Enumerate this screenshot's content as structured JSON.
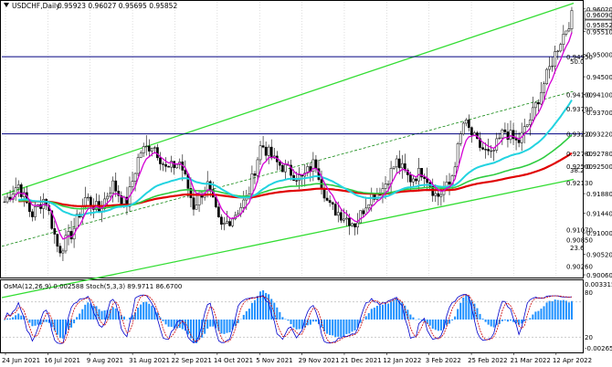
{
  "header": {
    "symbol": "USDCHF,Daily",
    "ohlc": "0.95923 0.96027 0.95695 0.95852"
  },
  "price_axis": {
    "ticks": [
      "0.96020",
      "0.95510",
      "0.95000",
      "0.94500",
      "0.94100",
      "0.93700",
      "0.93220",
      "0.92780",
      "0.92500",
      "0.91880",
      "0.91440",
      "0.91000",
      "0.90520",
      "0.90060"
    ],
    "ylim": [
      0.9002,
      0.9618
    ],
    "current_price": "0.95852",
    "tag_ask": "0.96090",
    "level_labels": [
      "0.94950",
      "0.94100",
      "0.93790",
      "0.93220",
      "0.92780",
      "0.92500",
      "0.92130",
      "0.91070",
      "0.90850",
      "0.90260"
    ]
  },
  "fib_labels": [
    "50.0",
    "38.2",
    "23.6"
  ],
  "time_axis": {
    "labels": [
      "24 Jun 2021",
      "16 Jul 2021",
      "9 Aug 2021",
      "31 Aug 2021",
      "22 Sep 2021",
      "14 Oct 2021",
      "5 Nov 2021",
      "29 Nov 2021",
      "21 Dec 2021",
      "12 Jan 2022",
      "3 Feb 2022",
      "25 Feb 2022",
      "21 Mar 2022",
      "12 Apr 2022"
    ]
  },
  "indicator": {
    "label": "OsMA(12,26,9) 0.002588  Stoch(5,3,3) 89.9711 86.6700",
    "axis_ticks": [
      "0.00331585",
      "80",
      "20",
      "-0.00265849"
    ]
  },
  "colors": {
    "bull_candle": "#000000",
    "bear_candle": "#000000",
    "ema_fast": "#d400d4",
    "ema_mid": "#22d3e0",
    "ema_slow_green": "#2ecc40",
    "ema_red": "#e00000",
    "channel": "#33dd33",
    "hline": "#000080",
    "osma": "#1e90ff",
    "stoch": "#0000cc"
  },
  "chart_data": {
    "type": "candlestick",
    "x": [
      "24 Jun 2021",
      "16 Jul 2021",
      "9 Aug 2021",
      "31 Aug 2021",
      "22 Sep 2021",
      "14 Oct 2021",
      "5 Nov 2021",
      "29 Nov 2021",
      "21 Dec 2021",
      "12 Jan 2022",
      "3 Feb 2022",
      "25 Feb 2022",
      "21 Mar 2022",
      "12 Apr 2022"
    ],
    "close_path": [
      0.917,
      0.921,
      0.914,
      0.918,
      0.906,
      0.91,
      0.918,
      0.915,
      0.921,
      0.916,
      0.928,
      0.93,
      0.924,
      0.926,
      0.916,
      0.921,
      0.911,
      0.914,
      0.918,
      0.93,
      0.926,
      0.924,
      0.922,
      0.926,
      0.916,
      0.914,
      0.912,
      0.918,
      0.92,
      0.926,
      0.922,
      0.924,
      0.918,
      0.921,
      0.935,
      0.93,
      0.927,
      0.933,
      0.93,
      0.936,
      0.944,
      0.952,
      0.9585
    ],
    "horizontal_levels": [
      0.9495,
      0.9322
    ],
    "channel_upper": [
      [
        0,
        0.9185
      ],
      [
        1,
        0.9615
      ]
    ],
    "channel_lower": [
      [
        0,
        0.8955
      ],
      [
        1,
        0.922
      ]
    ]
  }
}
